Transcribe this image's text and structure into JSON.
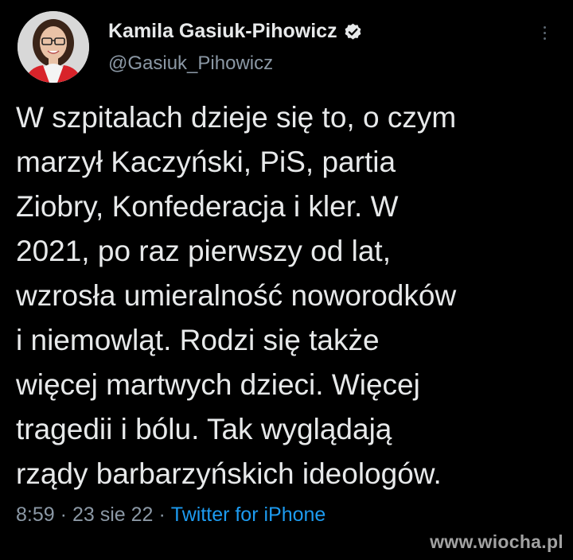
{
  "author": {
    "display_name": "Kamila Gasiuk-Pihowicz",
    "handle": "@Gasiuk_Pihowicz",
    "verified": true
  },
  "icons": {
    "verified": "verified-badge-icon",
    "more": "more-options-icon"
  },
  "tweet": {
    "lines": [
      "W szpitalach dzieje się to, o czym",
      "marzył Kaczyński, PiS, partia",
      "Ziobry, Konfederacja i kler. W",
      "2021, po raz pierwszy od lat,",
      "wzrosła umieralność noworodków",
      "i niemowląt. Rodzi się także",
      "więcej martwych dzieci. Więcej",
      "tragedii i bólu. Tak wyglądają",
      "rządy barbarzyńskich ideologów."
    ]
  },
  "meta": {
    "time": "8:59",
    "separator": "·",
    "date": "23 sie 22",
    "source": "Twitter for iPhone"
  },
  "watermark": "www.wiocha.pl",
  "colors": {
    "background": "#000000",
    "text": "#e7e9ea",
    "secondary": "#8b98a5",
    "link": "#1d9bf0"
  }
}
